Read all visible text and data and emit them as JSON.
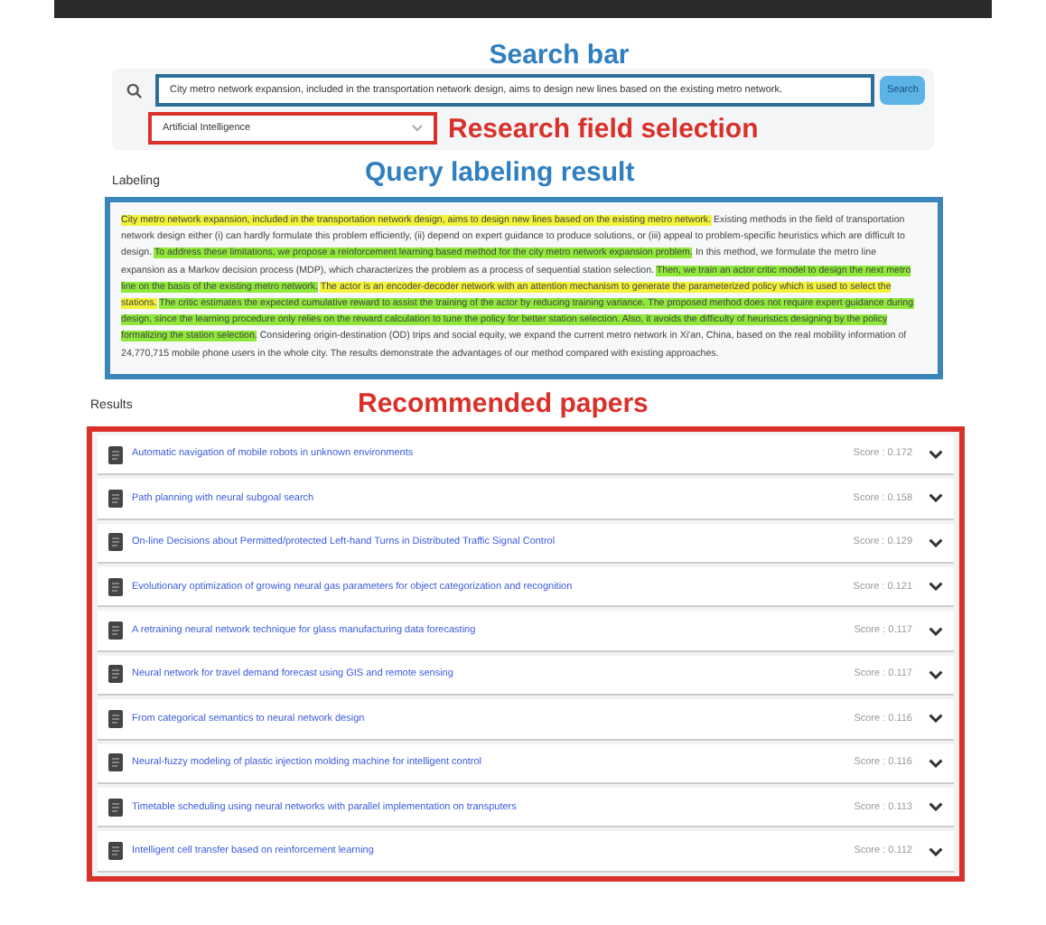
{
  "search": {
    "annotation": {
      "text": "Search bar",
      "color": "#2f7fc1"
    },
    "value": "City metro network expansion, included in the transportation network design, aims to design new lines based on the existing metro network.",
    "button": "Search",
    "field": "Artificial Intelligence",
    "field_annotation": {
      "text": "Research field selection",
      "color": "#d9312a"
    }
  },
  "labeling": {
    "heading": "Labeling",
    "annotation": {
      "text": "Query labeling result",
      "color": "#2f7fc1"
    },
    "segments": [
      {
        "text": "City metro network expansion, included in the transportation network design, aims to design new lines based on the existing metro network.",
        "color": "#f2f23a"
      },
      {
        "text": "Existing methods in the field of transportation network design either (i) can hardly formulate this problem efficiently, (ii) depend on expert guidance to produce solutions, or (iii) appeal to problem-specific heuristics which are difficult to design."
      },
      {
        "text": "To address these limitations, we propose a reinforcement learning based method for the city metro network expansion problem.",
        "color": "#8fe83a"
      },
      {
        "text": "In this method, we formulate the metro line expansion as a Markov decision process (MDP), which characterizes the problem as a process of sequential station selection."
      },
      {
        "text": "Then, we train an actor critic model to design the next metro line on the basis of the existing metro network.",
        "color": "#8fe83a"
      },
      {
        "text": "The actor is an encoder-decoder network with an attention mechanism to generate the parameterized policy which is used to select the stations.",
        "color": "#f2f23a"
      },
      {
        "text": "The critic estimates the expected cumulative reward to assist the training of the actor by reducing training variance. The proposed method does not require expert guidance during design, since the learning procedure only relies on the reward calculation to tune the policy for better station selection. Also, it avoids the difficulty of heuristics designing by the policy formalizing the station selection.",
        "color": "#8fe83a"
      },
      {
        "text": "Considering origin-destination (OD) trips and social equity, we expand the current metro network in Xi'an, China, based on the real mobility information of 24,770,715 mobile phone users in the whole city. The results demonstrate the advantages of our method compared with existing approaches."
      }
    ]
  },
  "results": {
    "heading": "Results",
    "annotation": {
      "text": "Recommended papers",
      "color": "#d9312a"
    },
    "papers": [
      {
        "title": "Automatic navigation of mobile robots in unknown environments",
        "score": "Score : 0.172"
      },
      {
        "title": "Path planning with neural subgoal search",
        "score": "Score : 0.158"
      },
      {
        "title": "On-line Decisions about Permitted/protected Left-hand Turns in Distributed Traffic Signal Control",
        "score": "Score : 0.129"
      },
      {
        "title": "Evolutionary optimization of growing neural gas parameters for object categorization and recognition",
        "score": "Score : 0.121"
      },
      {
        "title": "A retraining neural network technique for glass manufacturing data forecasting",
        "score": "Score : 0.117"
      },
      {
        "title": "Neural network for travel demand forecast using GIS and remote sensing",
        "score": "Score : 0.117"
      },
      {
        "title": "From categorical semantics to neural network design",
        "score": "Score : 0.116"
      },
      {
        "title": "Neural-fuzzy modeling of plastic injection molding machine for intelligent control",
        "score": "Score : 0.116"
      },
      {
        "title": "Timetable scheduling using neural networks with parallel implementation on transputers",
        "score": "Score : 0.113"
      },
      {
        "title": "Intelligent cell transfer based on reinforcement learning",
        "score": "Score : 0.112"
      }
    ]
  }
}
